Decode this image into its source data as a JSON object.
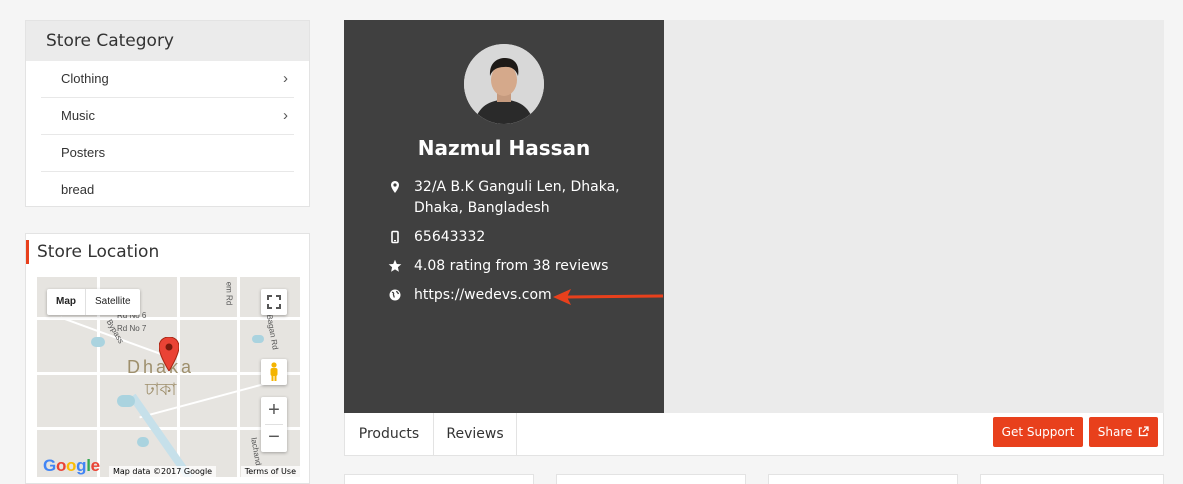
{
  "category_widget": {
    "title": "Store Category",
    "items": [
      {
        "label": "Clothing",
        "has_children": true
      },
      {
        "label": "Music",
        "has_children": true
      },
      {
        "label": "Posters",
        "has_children": false
      },
      {
        "label": "bread",
        "has_children": false
      }
    ]
  },
  "location_widget": {
    "title": "Store Location",
    "map": {
      "type_map": "Map",
      "type_satellite": "Satellite",
      "city_label": "Dhaka",
      "city_label_local": "ঢাকা",
      "street_labels": [
        "Rd No 6",
        "Rd No 7",
        "Bypass",
        "em Rd",
        "Lichu Bagan Rd",
        "D",
        "lachand"
      ],
      "google": "Google",
      "map_data": "Map data ©2017 Google",
      "terms": "Terms of Use",
      "zoom_in": "+",
      "zoom_out": "−"
    }
  },
  "profile": {
    "store_name": "Nazmul Hassan",
    "address_line1": "32/A B.K Ganguli Len, Dhaka,",
    "address_line2": "Dhaka, Bangladesh",
    "phone": "65643332",
    "rating": "4.08 rating from 38 reviews",
    "website": "https://wedevs.com"
  },
  "tabs": {
    "products": "Products",
    "reviews": "Reviews",
    "get_support": "Get Support",
    "share": "Share"
  },
  "colors": {
    "accent": "#e8401c",
    "profile_bg": "#404040"
  }
}
